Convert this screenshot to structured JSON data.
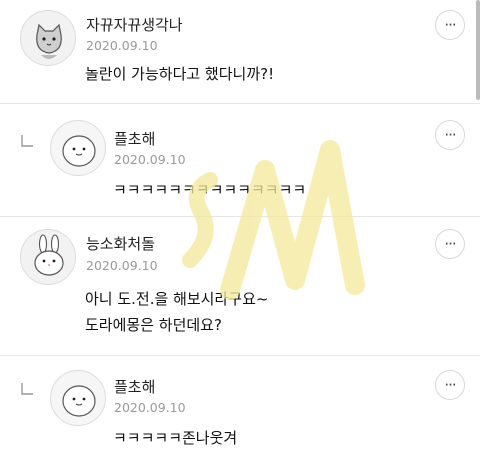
{
  "comments": [
    {
      "username": "자뀨자뀨생각나",
      "date": "2020.09.10",
      "lines": [
        "놀란이 가능하다고 했다니까?!"
      ],
      "more_icon": "more-dots-icon"
    },
    {
      "username": "플초해",
      "date": "2020.09.10",
      "lines": [
        "ㅋㅋㅋㅋㅋㅋㅋㅋㅋㅋㅋㅋㅋㅋ"
      ],
      "more_icon": "more-dots-icon",
      "is_reply": true
    },
    {
      "username": "능소화처돌",
      "date": "2020.09.10",
      "lines": [
        "아니 도.전.을 해보시라구요~",
        "도라에몽은 하던데요?"
      ],
      "more_icon": "more-dots-icon"
    },
    {
      "username": "플초해",
      "date": "2020.09.10",
      "lines": [
        "ㅋㅋㅋㅋㅋ존나웃겨"
      ],
      "more_icon": "more-dots-icon",
      "is_reply": true
    }
  ],
  "more_label": "···",
  "watermark": {
    "color": "#f3e89a",
    "text": "SM"
  }
}
